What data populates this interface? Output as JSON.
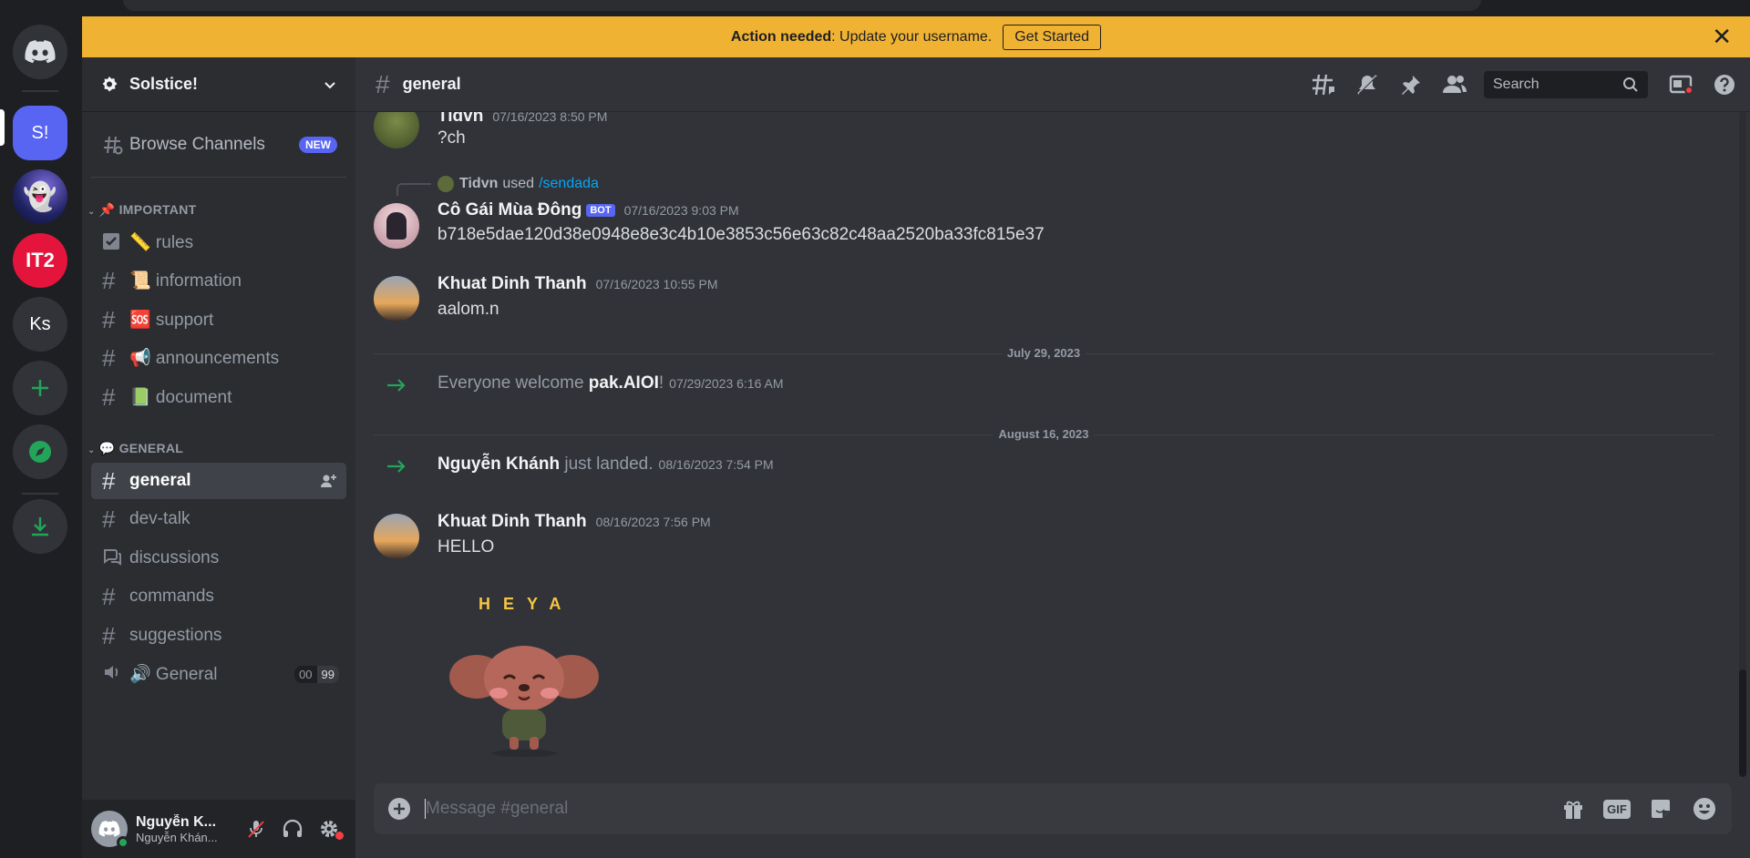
{
  "banner": {
    "bold": "Action needed",
    "text": ": Update your username.",
    "button": "Get Started",
    "close": "✕"
  },
  "rail": {
    "servers": [
      {
        "label": "S!",
        "color": "#5865f2",
        "selected": true
      },
      {
        "label": "",
        "color": "#2b2f5c"
      },
      {
        "label": "IT2",
        "color": "#e4143c"
      },
      {
        "label": "Ks",
        "color": "#313338"
      }
    ]
  },
  "sidebar": {
    "server_name": "Solstice!",
    "browse": {
      "label": "Browse Channels",
      "badge": "NEW"
    },
    "categories": [
      {
        "name": "📌 IMPORTANT",
        "channels": [
          {
            "label": "📏 rules",
            "icon": "rules-checkbox-icon"
          },
          {
            "label": "📜 information",
            "icon": "hash-icon"
          },
          {
            "label": "🆘 support",
            "icon": "hash-icon"
          },
          {
            "label": "📢 announcements",
            "icon": "hash-icon"
          },
          {
            "label": "📗 document",
            "icon": "hash-icon"
          }
        ]
      },
      {
        "name": "💬 GENERAL",
        "channels": [
          {
            "label": "general",
            "icon": "hash-icon",
            "selected": true
          },
          {
            "label": "dev-talk",
            "icon": "hash-icon"
          },
          {
            "label": "discussions",
            "icon": "forum-icon"
          },
          {
            "label": "commands",
            "icon": "hash-icon"
          },
          {
            "label": "suggestions",
            "icon": "hash-icon"
          },
          {
            "label": "🔊 General",
            "icon": "speaker-icon",
            "counter_left": "00",
            "counter_right": "99"
          }
        ]
      }
    ],
    "user": {
      "name": "Nguyễn K...",
      "status": "Nguyễn Khán..."
    }
  },
  "header": {
    "channel": "general",
    "search_placeholder": "Search"
  },
  "messages": [
    {
      "author": "Tidvn",
      "time": "07/16/2023 8:50 PM",
      "text": "?ch"
    },
    {
      "reply_author": "Tidvn",
      "reply_used": "used",
      "reply_cmd": "/sendada",
      "author": "Cô  Gái Mùa Đông",
      "badge": "BOT",
      "time": "07/16/2023 9:03 PM",
      "text": "b718e5dae120d38e0948e8e3c4b10e3853c56e63c82c48aa2520ba33fc815e37"
    },
    {
      "author": "Khuat Dinh Thanh",
      "time": "07/16/2023 10:55 PM",
      "text": "aalom.n"
    },
    {
      "divider": "July 29, 2023"
    },
    {
      "system_pre": "Everyone welcome ",
      "system_name": "pak.AIOI",
      "system_post": "!",
      "time": "07/29/2023 6:16 AM"
    },
    {
      "divider": "August 16, 2023"
    },
    {
      "system_name": "Nguyễn Khánh",
      "system_post": " just landed.",
      "time": "08/16/2023 7:54 PM"
    },
    {
      "author": "Khuat Dinh Thanh",
      "time": "08/16/2023 7:56 PM",
      "text": "HELLO",
      "sticker_text": "HEYA"
    }
  ],
  "composer": {
    "placeholder": "Message #general",
    "gif": "GIF"
  }
}
